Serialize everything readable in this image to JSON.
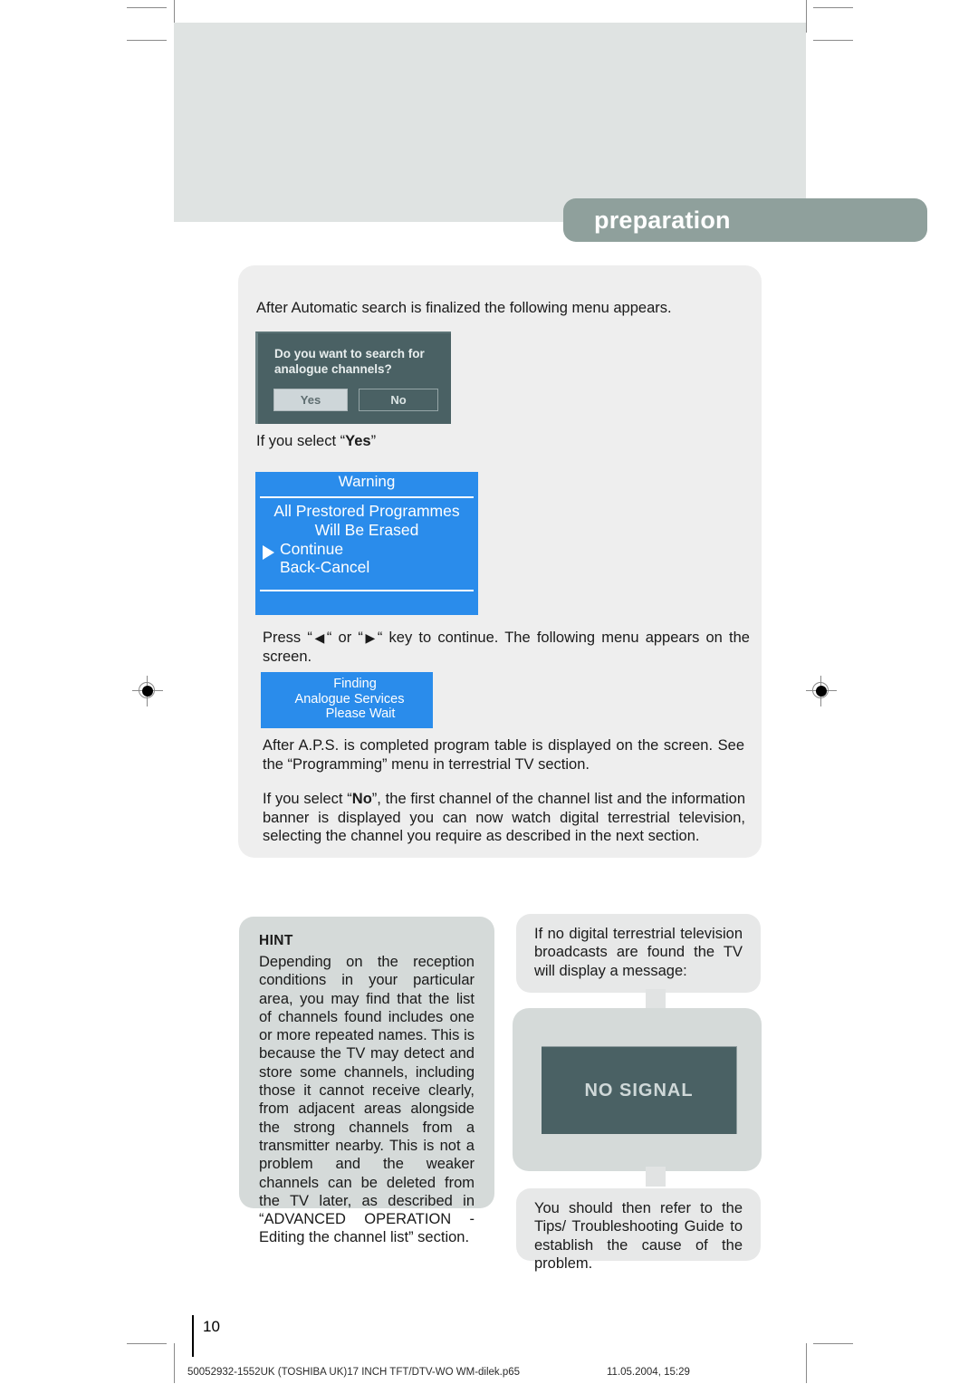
{
  "header": {
    "section_title": "preparation"
  },
  "content": {
    "intro": "After Automatic search is finalized the following menu appears.",
    "select_yes_prefix": "If you select “",
    "select_yes_bold": "Yes",
    "select_yes_suffix": "”",
    "press_key_before": "Press “",
    "press_key_left_icon": "◀",
    "press_key_mid": "“ or “",
    "press_key_right_icon": "▶",
    "press_key_after": "“ key to continue. The following menu appears on the screen.",
    "aps_paragraph": "After A.P.S. is completed program table is displayed on the screen. See the “Programming” menu in terrestrial TV section.",
    "no_paragraph_before": "If you select “",
    "no_paragraph_bold": "No",
    "no_paragraph_after": "”, the first channel of the channel list and the information banner is displayed you can now watch digital terrestrial television, selecting the channel you require as described in the next section."
  },
  "osd_question": {
    "question": "Do you want to search for analogue channels?",
    "yes_label": "Yes",
    "no_label": "No"
  },
  "osd_warning": {
    "title": "Warning",
    "line1": "All Prestored Programmes",
    "line2": "Will Be Erased",
    "option_continue": "Continue",
    "option_back_cancel": "Back-Cancel",
    "cursor_icon": "right-triangle-cursor-icon"
  },
  "osd_finding": {
    "line1": "Finding",
    "line2": "Analogue Services",
    "line3": "Please Wait"
  },
  "hint": {
    "title": "HINT",
    "text": "Depending on the reception conditions in your particular area, you may find that the list of channels found includes one or more repeated names. This is because the TV may detect and store some channels, including those it cannot receive clearly, from adjacent areas alongside the strong channels from a transmitter nearby. This is not a problem and the weaker channels can be deleted from the TV later, as described in “ADVANCED OPERATION - Editing the channel list” section."
  },
  "callouts": {
    "top_text": "If no digital terrestrial television broadcasts are found the TV will display a message:",
    "bottom_text": "You should then refer to the Tips/ Troubleshooting Guide to establish the cause of the problem."
  },
  "tv_screen": {
    "message": "NO SIGNAL"
  },
  "footer": {
    "page_number": "10",
    "file_name": "50052932-1552UK (TOSHIBA UK)17 INCH TFT/DTV-WO WM-dilek.p65",
    "timestamp": "11.05.2004, 15:29"
  },
  "colors": {
    "header_band": "#dfe3e2",
    "header_pill": "#8fa09c",
    "content_panel": "#eeeeee",
    "osd_blue": "#2a8ceb",
    "osd_teal": "#4a6164",
    "hint_grey": "#d5dad9",
    "callout_grey": "#e7e8e8"
  }
}
